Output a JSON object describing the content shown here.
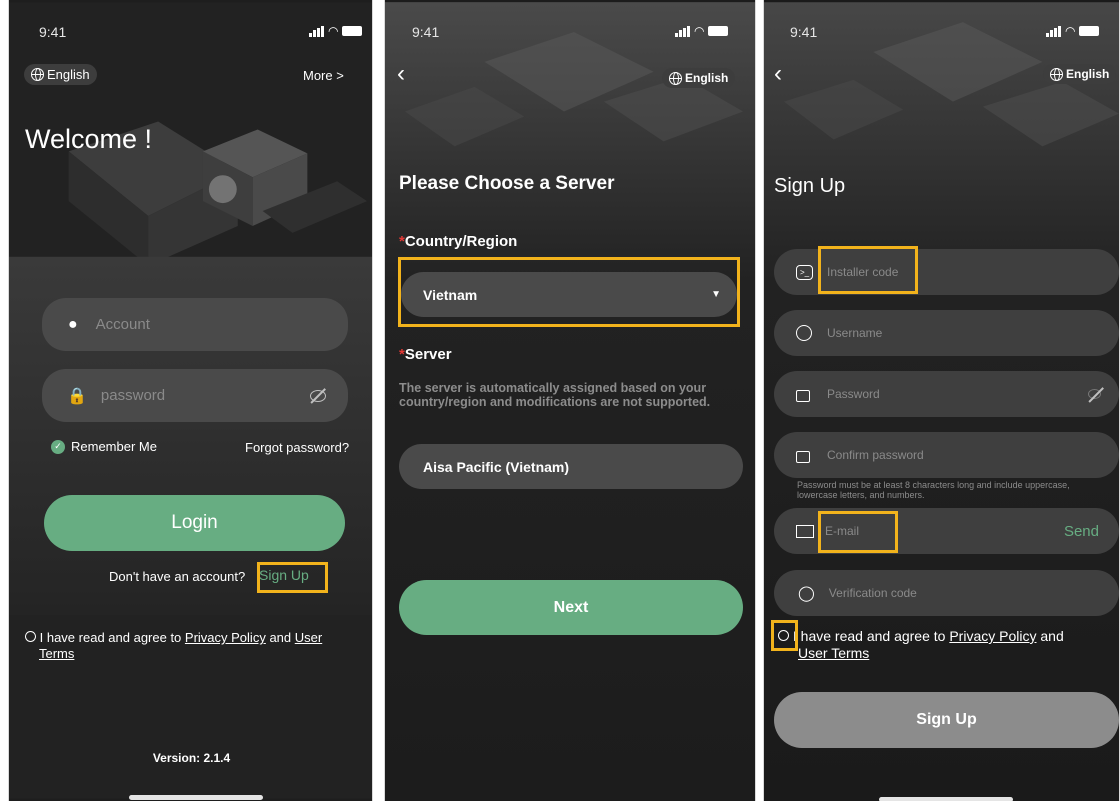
{
  "status": {
    "time": "9:41"
  },
  "screen1": {
    "language": "English",
    "more": "More >",
    "welcome": "Welcome !",
    "account_placeholder": "Account",
    "password_placeholder": "password",
    "remember_me": "Remember Me",
    "forgot_password": "Forgot password?",
    "login_button": "Login",
    "no_account_text": "Don't have an account?",
    "sign_up_link": "Sign Up",
    "agree_prefix": "I have read and agree to ",
    "privacy_policy": "Privacy Policy",
    "and_text": " and ",
    "user_terms_line1": "User",
    "user_terms_line2": "Terms",
    "version": "Version: 2.1.4"
  },
  "screen2": {
    "language": "English",
    "title": "Please Choose a Server",
    "country_label": "Country/Region",
    "country_value": "Vietnam",
    "server_label": "Server",
    "server_note": "The server is automatically assigned based on your country/region and modifications are not supported.",
    "server_value": "Aisa Pacific (Vietnam)",
    "next_button": "Next"
  },
  "screen3": {
    "language": "English",
    "title": "Sign Up",
    "installer_code_placeholder": "Installer code",
    "username_placeholder": "Username",
    "password_placeholder": "Password",
    "confirm_password_placeholder": "Confirm password",
    "password_hint": "Password must be at least 8 characters long and include uppercase, lowercase letters, and numbers.",
    "email_placeholder": "E-mail",
    "send_button": "Send",
    "verification_placeholder": "Verification code",
    "agree_prefix": "I have read and agree to ",
    "privacy_policy": "Privacy Policy",
    "and_text": " and",
    "user_terms": "User Terms",
    "sign_up_button": "Sign Up"
  },
  "colors": {
    "accent_green": "#67ad82",
    "highlight": "#f2b31c",
    "required_star": "#e53935",
    "field_bg": "#3f3f3f",
    "disabled_button": "#8c8c8c"
  }
}
